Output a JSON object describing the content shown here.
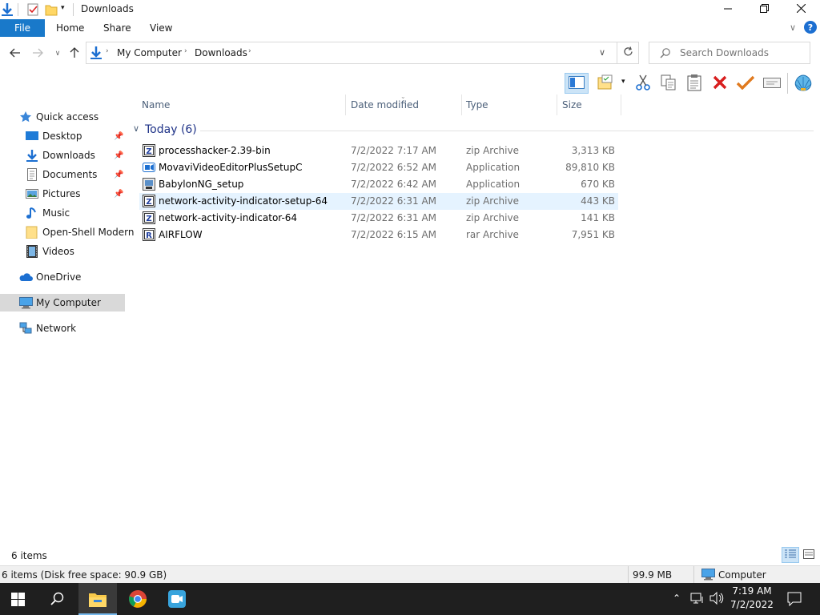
{
  "window": {
    "title": "Downloads"
  },
  "ribbon": {
    "file": "File",
    "home": "Home",
    "share": "Share",
    "view": "View"
  },
  "address": {
    "segments": [
      "My Computer",
      "Downloads"
    ]
  },
  "search": {
    "placeholder": "Search Downloads"
  },
  "nav": {
    "items": [
      {
        "label": "Quick access",
        "icon": "star-icon"
      },
      {
        "label": "Desktop",
        "icon": "desktop-icon",
        "pinned": true
      },
      {
        "label": "Downloads",
        "icon": "download-arrow-icon",
        "pinned": true
      },
      {
        "label": "Documents",
        "icon": "document-icon",
        "pinned": true
      },
      {
        "label": "Pictures",
        "icon": "pictures-icon",
        "pinned": true
      },
      {
        "label": "Music",
        "icon": "music-note-icon"
      },
      {
        "label": "Open-Shell Modern",
        "icon": "folder-icon"
      },
      {
        "label": "Videos",
        "icon": "video-icon"
      },
      {
        "label": "OneDrive",
        "icon": "cloud-icon"
      },
      {
        "label": "My Computer",
        "icon": "computer-icon",
        "selected": true
      },
      {
        "label": "Network",
        "icon": "network-icon"
      }
    ]
  },
  "columns": {
    "name": "Name",
    "date": "Date modified",
    "type": "Type",
    "size": "Size"
  },
  "group": {
    "label": "Today (6)"
  },
  "files": [
    {
      "name": "processhacker-2.39-bin",
      "date": "7/2/2022 7:17 AM",
      "type": "zip Archive",
      "size": "3,313 KB",
      "icon": "zip-archive-icon"
    },
    {
      "name": "MovaviVideoEditorPlusSetupC",
      "date": "7/2/2022 6:52 AM",
      "type": "Application",
      "size": "89,810 KB",
      "icon": "video-editor-app-icon"
    },
    {
      "name": "BabylonNG_setup",
      "date": "7/2/2022 6:42 AM",
      "type": "Application",
      "size": "670 KB",
      "icon": "installer-app-icon"
    },
    {
      "name": "network-activity-indicator-setup-64",
      "date": "7/2/2022 6:31 AM",
      "type": "zip Archive",
      "size": "443 KB",
      "icon": "zip-archive-icon",
      "hovered": true
    },
    {
      "name": "network-activity-indicator-64",
      "date": "7/2/2022 6:31 AM",
      "type": "zip Archive",
      "size": "141 KB",
      "icon": "zip-archive-icon"
    },
    {
      "name": "AIRFLOW",
      "date": "7/2/2022 6:15 AM",
      "type": "rar Archive",
      "size": "7,951 KB",
      "icon": "rar-archive-icon"
    }
  ],
  "status": {
    "items": "6 items",
    "disk": "6 items (Disk free space: 90.9 GB)",
    "size": "99.9 MB",
    "location": "Computer"
  },
  "taskbar": {
    "time": "7:19 AM",
    "date": "7/2/2022"
  },
  "colors": {
    "accent": "#1979ca",
    "selection": "#e5f3ff",
    "nav_selected": "#d9d9d9"
  }
}
